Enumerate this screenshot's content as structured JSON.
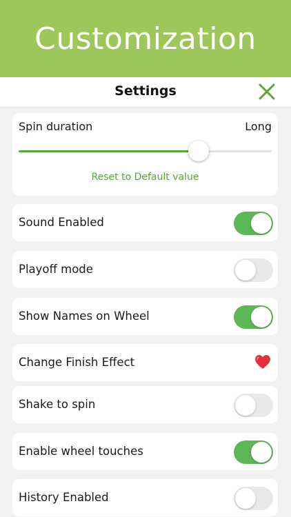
{
  "banner": {
    "title": "Customization"
  },
  "nav": {
    "title": "Settings",
    "close_icon": "close-icon"
  },
  "spin_duration": {
    "label": "Spin duration",
    "value": "Long",
    "level": 0.71,
    "reset_label": "Reset to Default value"
  },
  "settings": [
    {
      "label": "Sound Enabled",
      "on": true
    },
    {
      "label": "Playoff mode",
      "on": false
    },
    {
      "label": "Show Names on Wheel",
      "on": true
    },
    {
      "label": "Change Finish Effect",
      "icon": "heart-icon"
    },
    {
      "label": "Shake to spin",
      "on": false
    },
    {
      "label": "Enable wheel touches",
      "on": true
    },
    {
      "label": "History Enabled",
      "on": false
    }
  ],
  "colors": {
    "banner": "#9dc65b",
    "accent_green": "#55a83c",
    "toggle_on": "#5eb757",
    "toggle_off": "#e9e9eb",
    "heart": "#e3313b"
  }
}
